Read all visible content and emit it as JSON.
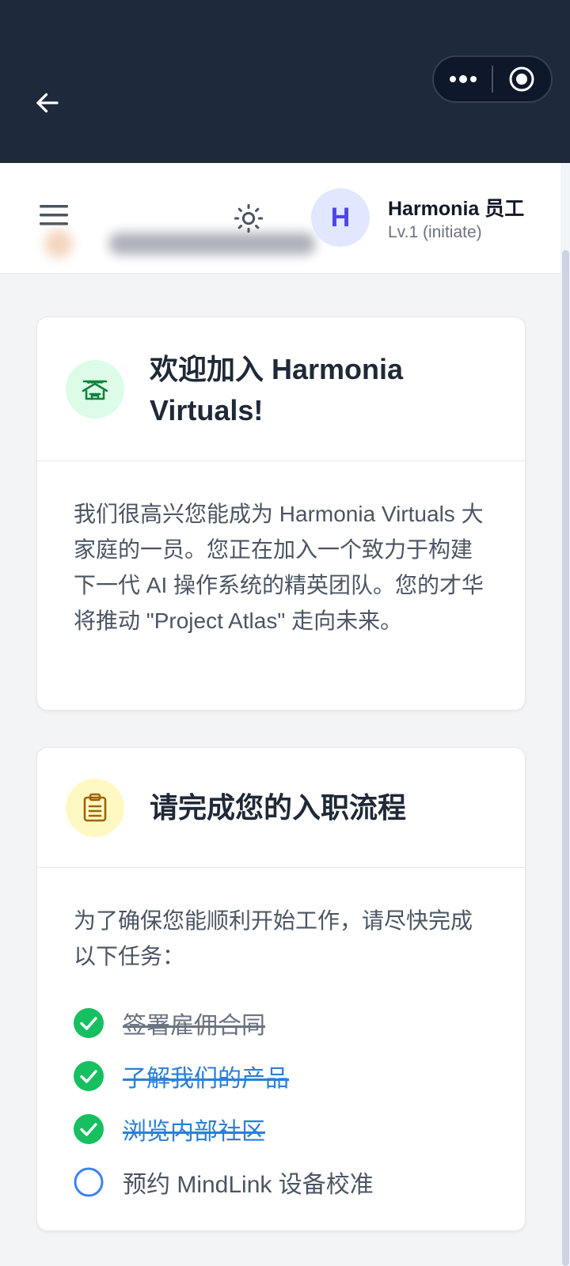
{
  "header": {
    "user_initial": "H",
    "user_name": "Harmonia 员工",
    "user_level": "Lv.1 (initiate)"
  },
  "welcome_card": {
    "title": "欢迎加入 Harmonia Virtuals!",
    "body": "我们很高兴您能成为 Harmonia Virtuals 大家庭的一员。您正在加入一个致力于构建下一代 AI 操作系统的精英团队。您的才华将推动 \"Project Atlas\" 走向未来。"
  },
  "onboarding_card": {
    "title": "请完成您的入职流程",
    "intro": "为了确保您能顺利开始工作，请尽快完成以下任务：",
    "tasks": [
      {
        "label": "签署雇佣合同",
        "done": true
      },
      {
        "label": "了解我们的产品",
        "done": true
      },
      {
        "label": "浏览内部社区",
        "done": true
      },
      {
        "label": "预约 MindLink 设备校准",
        "done": false
      }
    ]
  },
  "colors": {
    "topbar": "#1e293b",
    "accent": "#4f46e5",
    "success": "#16c060",
    "link": "#2b7fd6"
  }
}
